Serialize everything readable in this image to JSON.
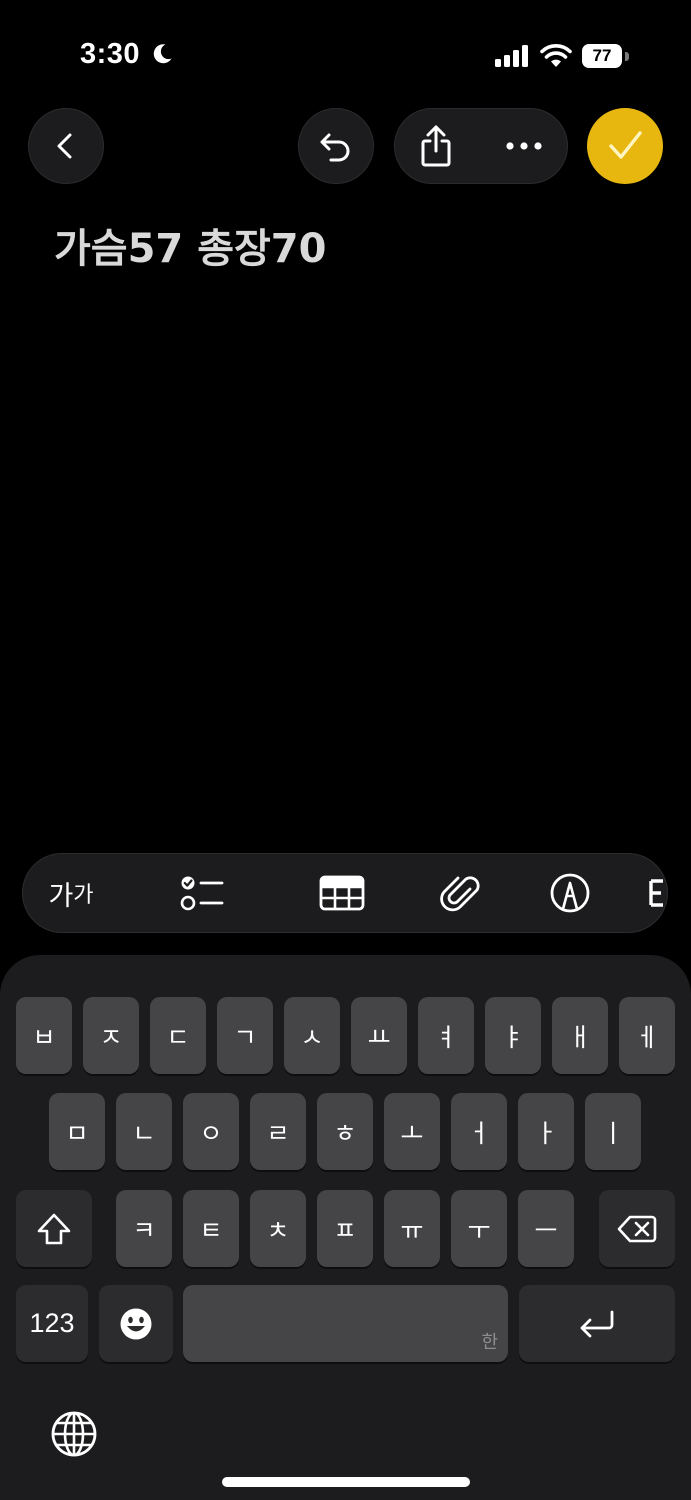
{
  "status_bar": {
    "time": "3:30",
    "battery_level": "77",
    "focus_icon": "moon-icon",
    "signal_icon": "cellular-signal-icon",
    "wifi_icon": "wifi-icon"
  },
  "toolbar": {
    "back_icon": "chevron-left-icon",
    "undo_icon": "undo-icon",
    "share_icon": "share-icon",
    "more_icon": "ellipsis-icon",
    "done_icon": "checkmark-icon",
    "accent_color": "#e8b70f"
  },
  "note": {
    "title": "가슴57 총장70"
  },
  "format_bar": {
    "text_style_label_large": "가",
    "text_style_label_small": "가",
    "checklist_icon": "checklist-icon",
    "table_icon": "table-icon",
    "attachment_icon": "paperclip-icon",
    "markup_icon": "pen-circle-icon"
  },
  "keyboard": {
    "row1": [
      "ㅂ",
      "ㅈ",
      "ㄷ",
      "ㄱ",
      "ㅅ",
      "ㅛ",
      "ㅕ",
      "ㅑ",
      "ㅐ",
      "ㅔ"
    ],
    "row2": [
      "ㅁ",
      "ㄴ",
      "ㅇ",
      "ㄹ",
      "ㅎ",
      "ㅗ",
      "ㅓ",
      "ㅏ",
      "ㅣ"
    ],
    "row3": [
      "ㅋ",
      "ㅌ",
      "ㅊ",
      "ㅍ",
      "ㅠ",
      "ㅜ",
      "ㅡ"
    ],
    "shift_icon": "shift-icon",
    "delete_icon": "delete-backward-icon",
    "numbers_label": "123",
    "emoji_icon": "emoji-icon",
    "space_hint": "한",
    "return_icon": "return-icon",
    "globe_icon": "globe-icon"
  }
}
